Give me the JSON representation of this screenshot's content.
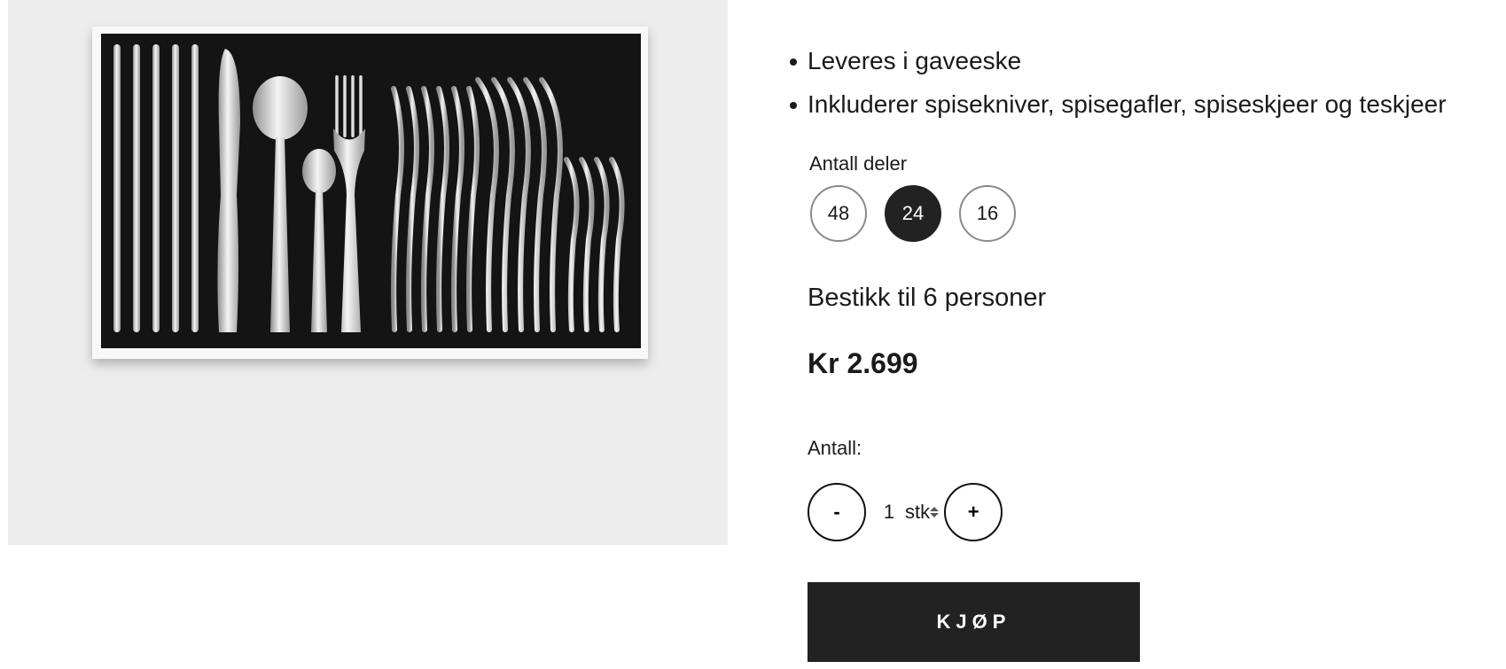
{
  "product": {
    "image_alt": "Bestikksett i gaveeske",
    "features": [
      "Leveres i gaveeske",
      "Inkluderer spisekniver, spisegafler, spiseskjeer og teskjeer"
    ],
    "variant": {
      "label": "Antall deler",
      "options": [
        "48",
        "24",
        "16"
      ],
      "selected": "24",
      "description": "Bestikk til 6 personer"
    },
    "price": "Kr 2.699",
    "quantity": {
      "label": "Antall:",
      "value": "1",
      "unit": "stk",
      "decrement": "-",
      "increment": "+"
    },
    "buy_label": "KJØP"
  },
  "colors": {
    "image_bg": "#ededed",
    "dark": "#222222",
    "text": "#1a1a1a"
  }
}
